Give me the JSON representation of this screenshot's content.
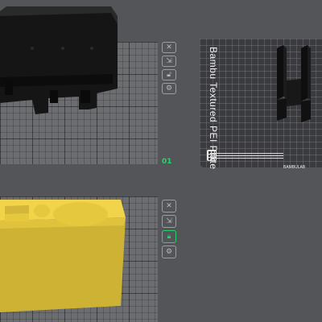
{
  "plates": [
    {
      "number": "",
      "state": "unlocked"
    },
    {
      "number": "01",
      "label": "",
      "plate_text": "Bambu Textured PEI Plate",
      "logo_text": "BAMBULAB"
    },
    {
      "number": "",
      "state": "locked"
    }
  ],
  "tools": [
    {
      "icon": "close-icon"
    },
    {
      "icon": "arrange-icon"
    },
    {
      "icon": "lock-icon"
    },
    {
      "icon": "settings-icon"
    }
  ],
  "colors": {
    "background": "#545559",
    "plate": "#6c6d70",
    "textured_plate": "#3a3b3e",
    "accent": "#2bd16a",
    "model_dark": "#161616",
    "model_yellow": "#e8c53e"
  }
}
